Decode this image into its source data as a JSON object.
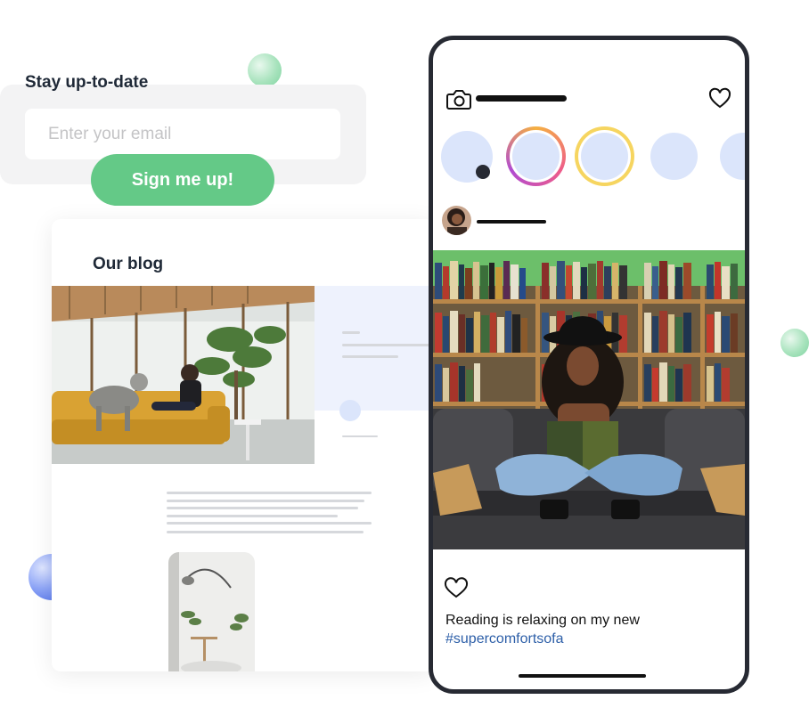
{
  "newsletter": {
    "title": "Stay up-to-date",
    "email_placeholder": "Enter your email",
    "button_label": "Sign me up!"
  },
  "blog": {
    "title": "Our blog"
  },
  "phone": {
    "icons": {
      "camera": "camera-icon",
      "like_top": "heart-icon",
      "like_post": "heart-icon"
    },
    "post": {
      "caption_text": "Reading is relaxing on my new",
      "hashtag": "#supercomfortsofa"
    }
  },
  "colors": {
    "accent_green": "#64c987",
    "hashtag_blue": "#2d5fa8",
    "phone_frame": "#272a33",
    "story_placeholder": "#dbe5fb"
  }
}
